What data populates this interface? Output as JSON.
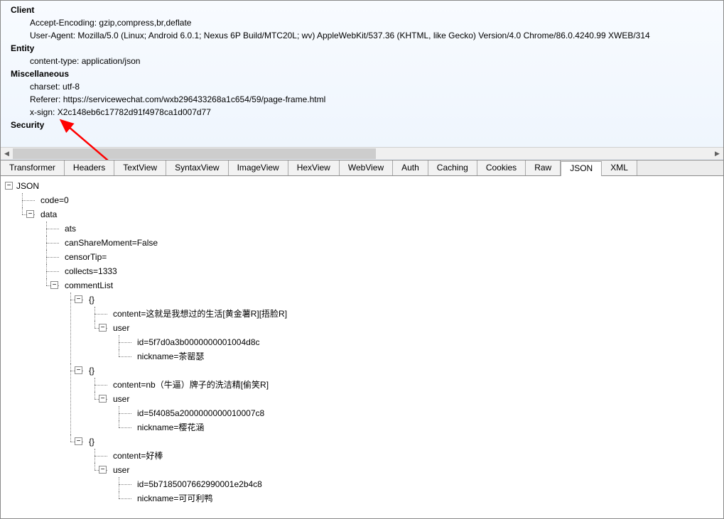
{
  "headers": {
    "client": {
      "title": "Client",
      "accept_encoding_label": "Accept-Encoding:",
      "accept_encoding_value": "gzip,compress,br,deflate",
      "user_agent_label": "User-Agent:",
      "user_agent_value": "Mozilla/5.0 (Linux; Android 6.0.1; Nexus 6P Build/MTC20L; wv) AppleWebKit/537.36 (KHTML, like Gecko) Version/4.0 Chrome/86.0.4240.99 XWEB/314"
    },
    "entity": {
      "title": "Entity",
      "content_type_label": "content-type:",
      "content_type_value": "application/json"
    },
    "miscellaneous": {
      "title": "Miscellaneous",
      "charset_label": "charset:",
      "charset_value": "utf-8",
      "referer_label": "Referer:",
      "referer_value": "https://servicewechat.com/wxb296433268a1c654/59/page-frame.html",
      "xsign_label": "x-sign:",
      "xsign_value": "X2c148eb6c17782d91f4978ca1d007d77"
    },
    "security": {
      "title": "Security"
    }
  },
  "tabs": [
    {
      "label": "Transformer"
    },
    {
      "label": "Headers"
    },
    {
      "label": "TextView"
    },
    {
      "label": "SyntaxView"
    },
    {
      "label": "ImageView"
    },
    {
      "label": "HexView"
    },
    {
      "label": "WebView"
    },
    {
      "label": "Auth"
    },
    {
      "label": "Caching"
    },
    {
      "label": "Cookies"
    },
    {
      "label": "Raw"
    },
    {
      "label": "JSON",
      "selected": true
    },
    {
      "label": "XML"
    }
  ],
  "tree": {
    "root_label": "JSON",
    "code": "code=0",
    "data": "data",
    "ats": "ats",
    "canShareMoment": "canShareMoment=False",
    "censorTip": "censorTip=",
    "collects": "collects=1333",
    "commentList": "commentList",
    "obj": "{}",
    "user": "user",
    "comment0_content": "content=这就是我想过的生活[黄金薯R][捂脸R]",
    "comment0_user_id": "id=5f7d0a3b0000000001004d8c",
    "comment0_user_nickname": "nickname=茶罂瑟",
    "comment1_content": "content=nb（牛逼）牌子的洗洁精[偷笑R]",
    "comment1_user_id": "id=5f4085a2000000000010007c8",
    "comment1_user_nickname": "nickname=樱花涵",
    "comment2_content": "content=好棒",
    "comment2_user_id": "id=5b7185007662990001e2b4c8",
    "comment2_user_nickname": "nickname=可可利鸭"
  }
}
